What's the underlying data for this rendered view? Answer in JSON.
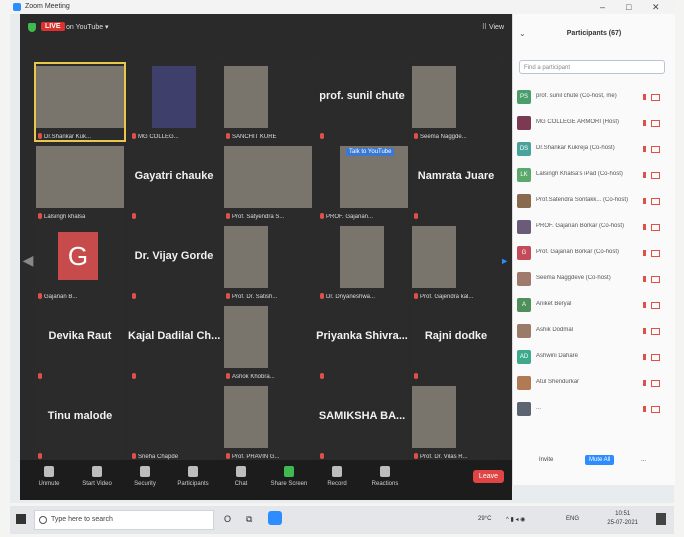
{
  "window": {
    "title": "Zoom Meeting",
    "controls": [
      "–",
      "□",
      "✕"
    ]
  },
  "topbar": {
    "live_badge": "LIVE",
    "stream": "on YouTube ▾",
    "view": "⠿ View"
  },
  "tiles": [
    {
      "kind": "video",
      "label": "Dr.Shankar Kuk...",
      "active": true
    },
    {
      "kind": "logo",
      "label": "MG COLLEG..."
    },
    {
      "kind": "video",
      "label": "SANCHIT KURE"
    },
    {
      "kind": "name",
      "name": "prof. sunil chute"
    },
    {
      "kind": "video",
      "label": "Seema Naggde..."
    },
    {
      "kind": "video",
      "label": "Lalsingh khalsa"
    },
    {
      "kind": "name",
      "name": "Gayatri chauke"
    },
    {
      "kind": "video",
      "label": "Prof. Satyendra S..."
    },
    {
      "kind": "video",
      "label": "PROF. Gajanan..."
    },
    {
      "kind": "name",
      "name": "Namrata Juare"
    },
    {
      "kind": "avatar",
      "letter": "G",
      "label": "Gajanan B..."
    },
    {
      "kind": "name",
      "name": "Dr. Vijay Gorde"
    },
    {
      "kind": "video",
      "label": "Prof. Dr. Satish..."
    },
    {
      "kind": "video",
      "label": "Dr. Dnyaneshwa..."
    },
    {
      "kind": "video",
      "label": "Prof. Gajendra kal..."
    },
    {
      "kind": "name",
      "name": "Devika Raut"
    },
    {
      "kind": "name",
      "name": "Kajal Dadilal Ch..."
    },
    {
      "kind": "video",
      "label": "Ashok Khobra..."
    },
    {
      "kind": "name",
      "name": "Priyanka Shivra..."
    },
    {
      "kind": "name",
      "name": "Rajni dodke"
    },
    {
      "kind": "name",
      "name": "Tinu malode"
    },
    {
      "kind": "name",
      "name": "",
      "label": "Sneha Chapde"
    },
    {
      "kind": "video",
      "label": "Prof. PRAVIN G..."
    },
    {
      "kind": "name",
      "name": "SAMIKSHA BA..."
    },
    {
      "kind": "video",
      "label": "Prof. Dr. Vilas R..."
    }
  ],
  "youtube_badge": "Talk to YouTube",
  "toolbar": {
    "buttons": [
      "Unmute",
      "Start Video",
      "Security",
      "Participants",
      "Chat",
      "Share Screen",
      "Record",
      "Reactions"
    ],
    "leave": "Leave"
  },
  "participants": {
    "title": "Participants (67)",
    "search_placeholder": "Find a participant",
    "list": [
      {
        "initials": "PS",
        "color": "#4a9e6b",
        "name": "prof. sunil chute (Co-host, me)"
      },
      {
        "initials": "",
        "color": "#7b3a52",
        "name": "MG COLLEGE ARMORI (Host)"
      },
      {
        "initials": "DS",
        "color": "#4aa39b",
        "name": "Dr.Shankar Kukreja (Co-host)"
      },
      {
        "initials": "LK",
        "color": "#5aa86c",
        "name": "Lalsingh Khalsa's iPad (Co-host)"
      },
      {
        "initials": "",
        "color": "#8a6a4e",
        "name": "Prof.Satendra Sontakk... (Co-host)"
      },
      {
        "initials": "",
        "color": "#6b5b7b",
        "name": "PROF. Gajanan Borkar (Co-host)"
      },
      {
        "initials": "G",
        "color": "#c44b5a",
        "name": "Prof. Gajanan Borkar (Co-host)"
      },
      {
        "initials": "",
        "color": "#a07b6b",
        "name": "Seema Naggdeve (Co-host)"
      },
      {
        "initials": "A",
        "color": "#4f8f5a",
        "name": "Aniket Beryal"
      },
      {
        "initials": "",
        "color": "#9a7b6a",
        "name": "Ashik Dodmal"
      },
      {
        "initials": "AD",
        "color": "#3fa98b",
        "name": "Ashwini Dahare"
      },
      {
        "initials": "",
        "color": "#b07a55",
        "name": "Atul Shendurkar"
      },
      {
        "initials": "",
        "color": "#5b6470",
        "name": "..."
      }
    ],
    "invite": "Invite",
    "mute_all": "Mute All",
    "more": "..."
  },
  "taskbar": {
    "search_placeholder": "Type here to search",
    "temperature": "29°C",
    "language": "ENG",
    "time": "10:51",
    "date": "25-07-2021"
  }
}
